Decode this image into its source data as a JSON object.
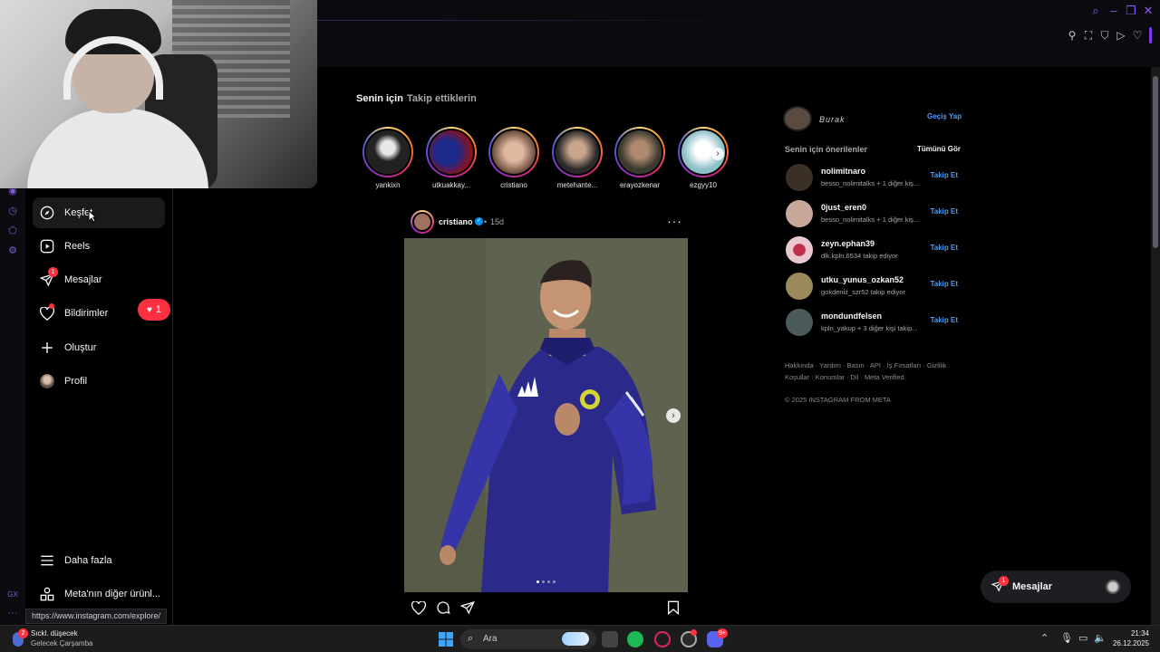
{
  "feed_tabs": {
    "for_you": "Senin için",
    "following": "Takip ettiklerin"
  },
  "nav": {
    "explore": "Keşfet",
    "reels": "Reels",
    "messages": "Mesajlar",
    "messages_badge": "1",
    "notifications": "Bildirimler",
    "notifications_badge": "1",
    "create": "Oluştur",
    "profile": "Profil",
    "more": "Daha fazla",
    "meta_more": "Meta'nın diğer ürünl..."
  },
  "stories": [
    {
      "name": "yankixn"
    },
    {
      "name": "utkuakkay..."
    },
    {
      "name": "cristiano"
    },
    {
      "name": "metehante..."
    },
    {
      "name": "erayozkenar"
    },
    {
      "name": "ezgyy10"
    }
  ],
  "post": {
    "author": "cristiano",
    "separator": "•",
    "time": "15d",
    "more_icon": "more-horizontal-icon"
  },
  "sidebar_right": {
    "current_user_name": "Burak",
    "switch_label": "Geçiş Yap",
    "suggestions_title": "Senin için önerilenler",
    "see_all": "Tümünü Gör",
    "follow_label": "Takip Et",
    "suggestions": [
      {
        "username": "nolimitnaro",
        "sub": "besso_nolimitalks + 1 diğer kiş...",
        "color": "#3b3026"
      },
      {
        "username": "0just_eren0",
        "sub": "besso_nolimitalks + 1 diğer kiş...",
        "color": "#c8a89a"
      },
      {
        "username": "zeyn.ephan39",
        "sub": "dlk.kpln.6534 takip ediyor",
        "color": "#8a2436"
      },
      {
        "username": "utku_yunus_ozkan52",
        "sub": "gokdeniz_szr52 takip ediyor",
        "color": "#9b8a5c"
      },
      {
        "username": "mondundfelsen",
        "sub": "kpln_yakup + 3 diğer kişi takip...",
        "color": "#4a5a5a"
      }
    ],
    "footer_line1": "Hakkında · Yardım · Basın · API · İş Fırsatları · Gizlilik ·",
    "footer_line2": "Koşullar · Konumlar · Dil · Meta Verified",
    "copyright": "© 2025 INSTAGRAM FROM META"
  },
  "floating_messages": {
    "label": "Mesajlar",
    "badge": "1"
  },
  "status_url": "https://www.instagram.com/explore/",
  "taskbar": {
    "weather_title": "Sıckl. düşecek",
    "weather_sub": "Gelecek Çarşamba",
    "weather_badge": "2",
    "search_label": "Ara",
    "time": "21:34",
    "date": "26.12.2025",
    "discord_badge": "9+"
  },
  "opera_strip": {
    "gx_label": "GX",
    "more_label": "···"
  },
  "colors": {
    "accent": "#8b5cf6",
    "follow_blue": "#4f9cf5",
    "notif_red": "#ff3040"
  }
}
